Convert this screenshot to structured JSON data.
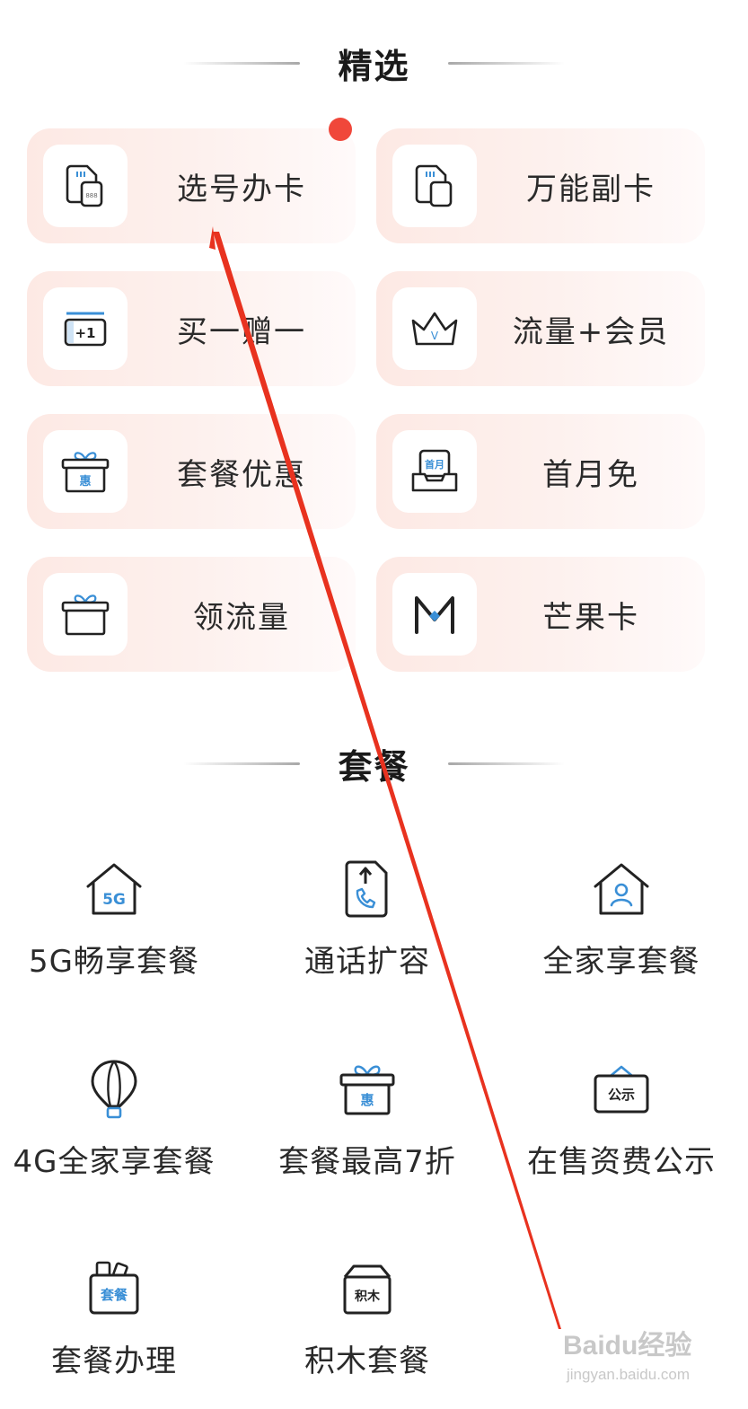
{
  "sections": {
    "featured_title": "精选",
    "packages_title": "套餐"
  },
  "featured": [
    {
      "label": "选号办卡",
      "icon": "sim-card-icon",
      "badge": true
    },
    {
      "label": "万能副卡",
      "icon": "sim-card-icon"
    },
    {
      "label": "买一赠一",
      "icon": "plus-one-card-icon",
      "icon_text": "+1"
    },
    {
      "label": "流量+会员",
      "icon": "crown-icon",
      "icon_text": "V"
    },
    {
      "label": "套餐优惠",
      "icon": "gift-box-icon",
      "icon_text": "惠"
    },
    {
      "label": "首月免",
      "icon": "first-month-tray-icon",
      "icon_text": "首月"
    },
    {
      "label": "领流量",
      "icon": "gift-box-icon"
    },
    {
      "label": "芒果卡",
      "icon": "mango-m-icon"
    }
  ],
  "packages": [
    {
      "label": "5G畅享套餐",
      "icon": "house-5g-icon",
      "icon_text": "5G"
    },
    {
      "label": "通话扩容",
      "icon": "phone-upgrade-icon"
    },
    {
      "label": "全家享套餐",
      "icon": "house-user-icon"
    },
    {
      "label": "4G全家享套餐",
      "icon": "hot-air-balloon-icon"
    },
    {
      "label": "套餐最高7折",
      "icon": "gift-box-icon",
      "icon_text": "惠"
    },
    {
      "label": "在售资费公示",
      "icon": "notice-board-icon",
      "icon_text": "公示"
    },
    {
      "label": "套餐办理",
      "icon": "package-bag-icon",
      "icon_text": "套餐"
    },
    {
      "label": "积木套餐",
      "icon": "building-block-box-icon",
      "icon_text": "积木"
    }
  ],
  "watermark": {
    "main": "Baidu经验",
    "sub": "jingyan.baidu.com"
  },
  "colors": {
    "accent": "#f0473a",
    "icon_blue": "#3a8fd6",
    "card_bg": "#fde9e4"
  }
}
